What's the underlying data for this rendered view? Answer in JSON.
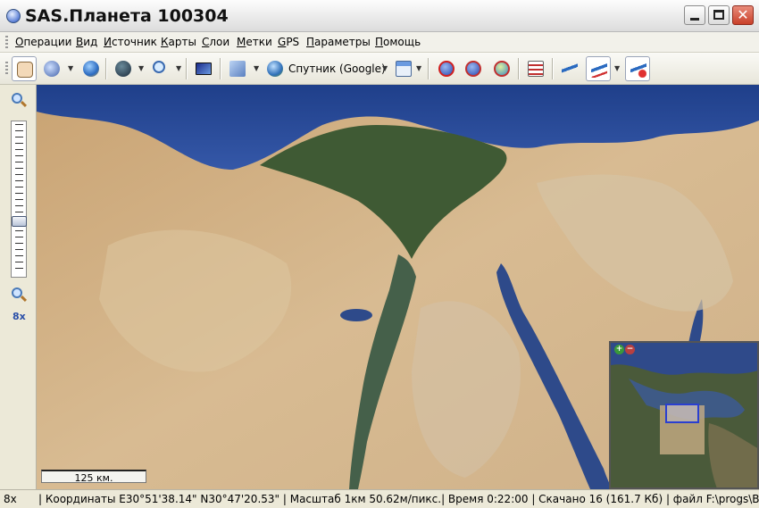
{
  "window": {
    "title": "SAS.Планета 100304",
    "controls": {
      "close_glyph": "✕"
    }
  },
  "menu": [
    "Операции",
    "Вид",
    "Источник",
    "Карты",
    "Слои",
    "Метки",
    "GPS",
    "Параметры",
    "Помощь"
  ],
  "toolbar": {
    "map_source_label": "Спутник (Google)",
    "buttons": [
      "hand-icon",
      "gps-device-icon",
      "globe-icon",
      "dark-globe-icon",
      "magnifier-icon",
      "screen-icon",
      "map-type-icon",
      "satellite-globe-icon",
      "calendar-icon",
      "pin-add-icon",
      "pin-delete-icon",
      "pin-edit-icon",
      "marks-list-icon",
      "path-icon",
      "ruler-icon",
      "route-delete-icon"
    ]
  },
  "zoom_panel": {
    "level_label": "8x",
    "slider_fraction": 0.35
  },
  "map": {
    "scale_label": "125 км.",
    "minimap": {
      "plus": "+",
      "minus": "−"
    }
  },
  "status": {
    "zoom": "8x",
    "text": "| Координаты E30°51'38.14\" N30°47'20.53\" | Масштаб 1км 50.62м/пикс.| Время 0:22:00 | Скачано 16 (161.7 Кб) | файл F:\\progs\\Brow"
  }
}
